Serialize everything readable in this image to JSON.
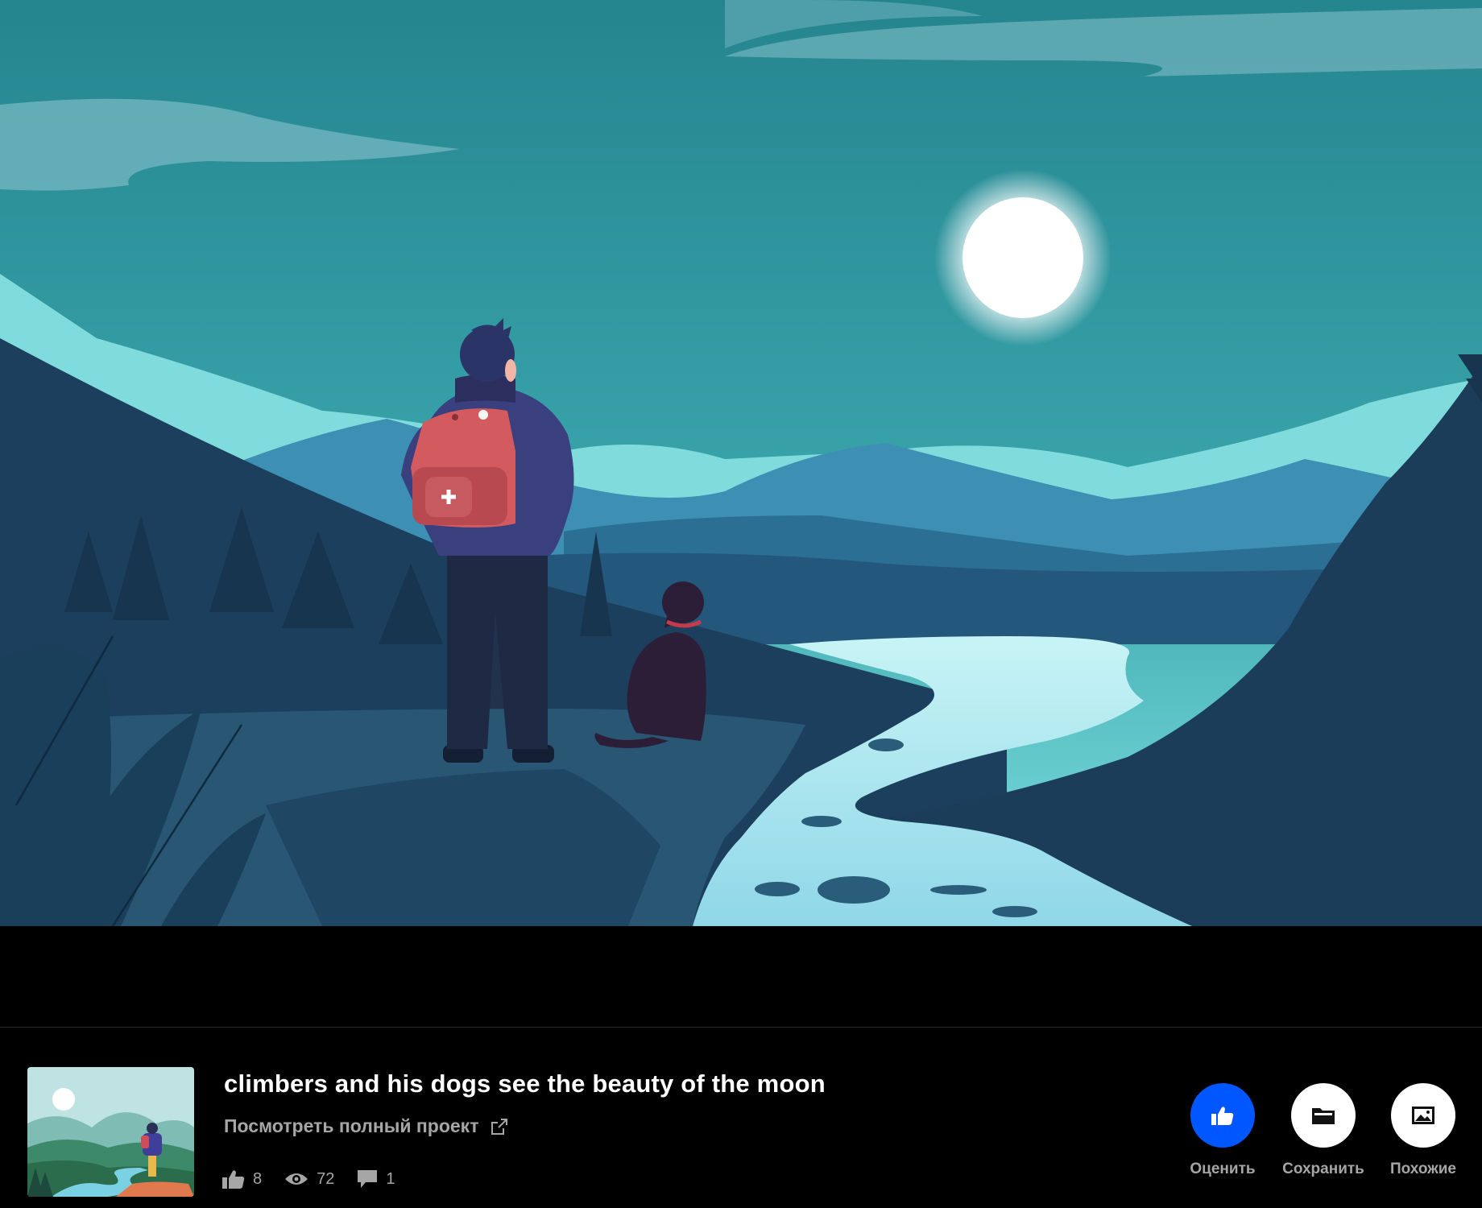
{
  "project": {
    "title": "climbers and his dogs see the beauty of the moon",
    "full_project_link": "Посмотреть полный проект"
  },
  "stats": {
    "likes": "8",
    "views": "72",
    "comments": "1"
  },
  "actions": {
    "appreciate_label": "Оценить",
    "save_label": "Сохранить",
    "similar_label": "Похожие"
  },
  "icons": {
    "appreciate": "thumbs-up-icon",
    "save": "folder-icon",
    "similar": "image-icon",
    "external_link": "external-link-icon",
    "likes": "thumbs-up-icon",
    "views": "eye-icon",
    "comments": "comment-icon"
  },
  "colors": {
    "accent": "#0057ff",
    "background": "#000000",
    "muted_text": "#a6a6a6",
    "title_text": "#ffffff"
  }
}
